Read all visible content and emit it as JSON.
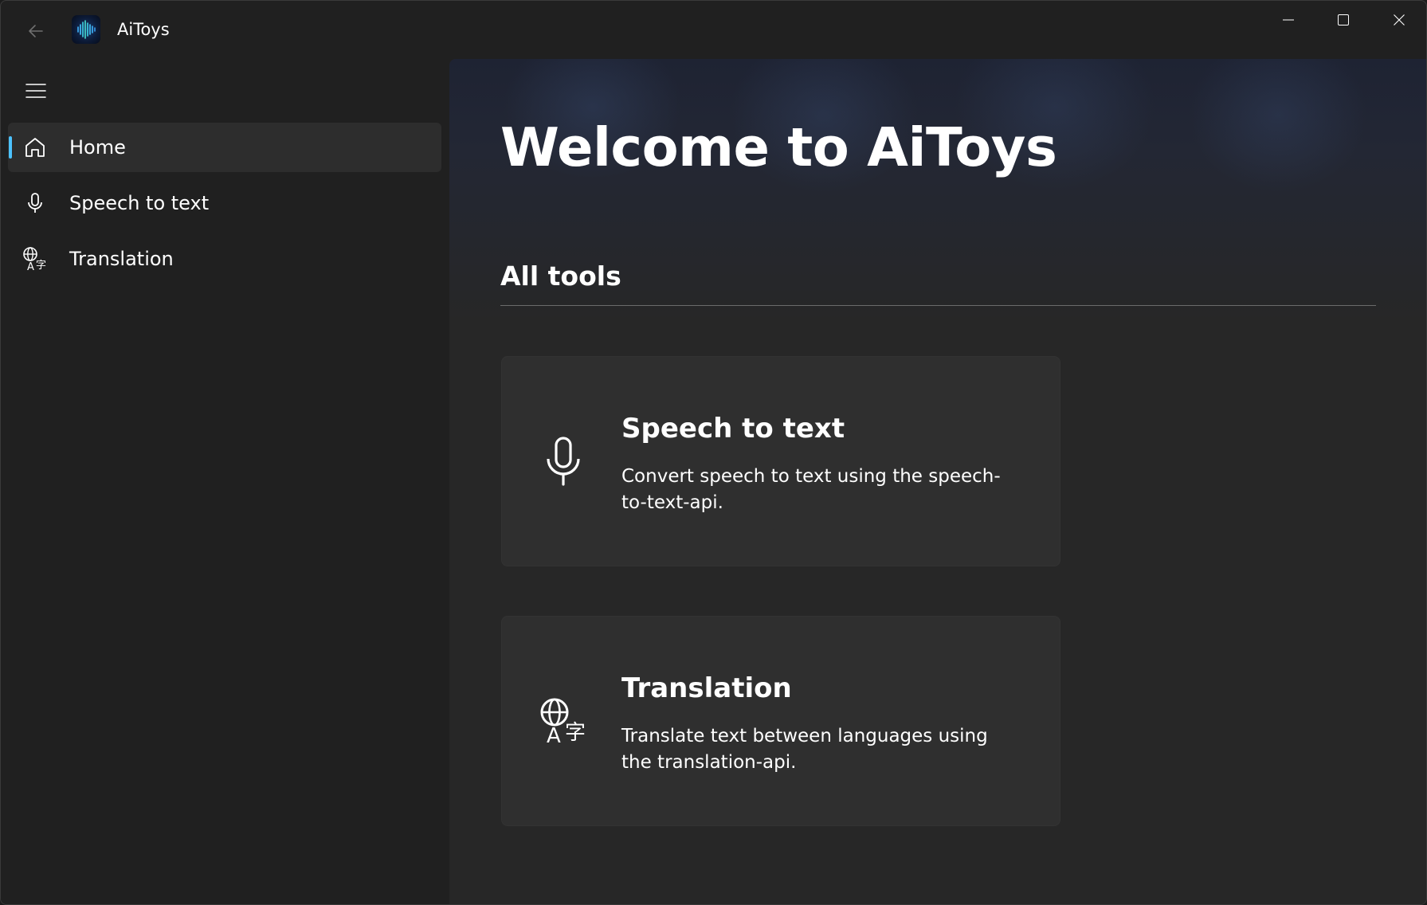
{
  "window": {
    "title": "AiToys",
    "back_icon": "arrow-left-icon",
    "logo_icon": "app-logo-waveform-icon",
    "controls": [
      "minimize-icon",
      "maximize-icon",
      "close-icon"
    ]
  },
  "sidebar": {
    "menu_icon": "hamburger-menu-icon",
    "items": [
      {
        "label": "Home",
        "icon": "home-icon",
        "selected": true
      },
      {
        "label": "Speech to text",
        "icon": "microphone-icon",
        "selected": false
      },
      {
        "label": "Translation",
        "icon": "translate-icon",
        "selected": false
      }
    ]
  },
  "main": {
    "title": "Welcome to AiToys",
    "section_title": "All tools",
    "cards": [
      {
        "title": "Speech to text",
        "description": "Convert speech to text using the speech-to-text-api.",
        "icon": "microphone-icon"
      },
      {
        "title": "Translation",
        "description": "Translate text between languages using the translation-api.",
        "icon": "translate-icon"
      }
    ]
  },
  "colors": {
    "accent": "#4cc2ff",
    "window_bg": "#202020",
    "content_bg": "#272727",
    "card_bg": "#2f2f2f",
    "selected_item_bg": "#2d2d2d"
  }
}
